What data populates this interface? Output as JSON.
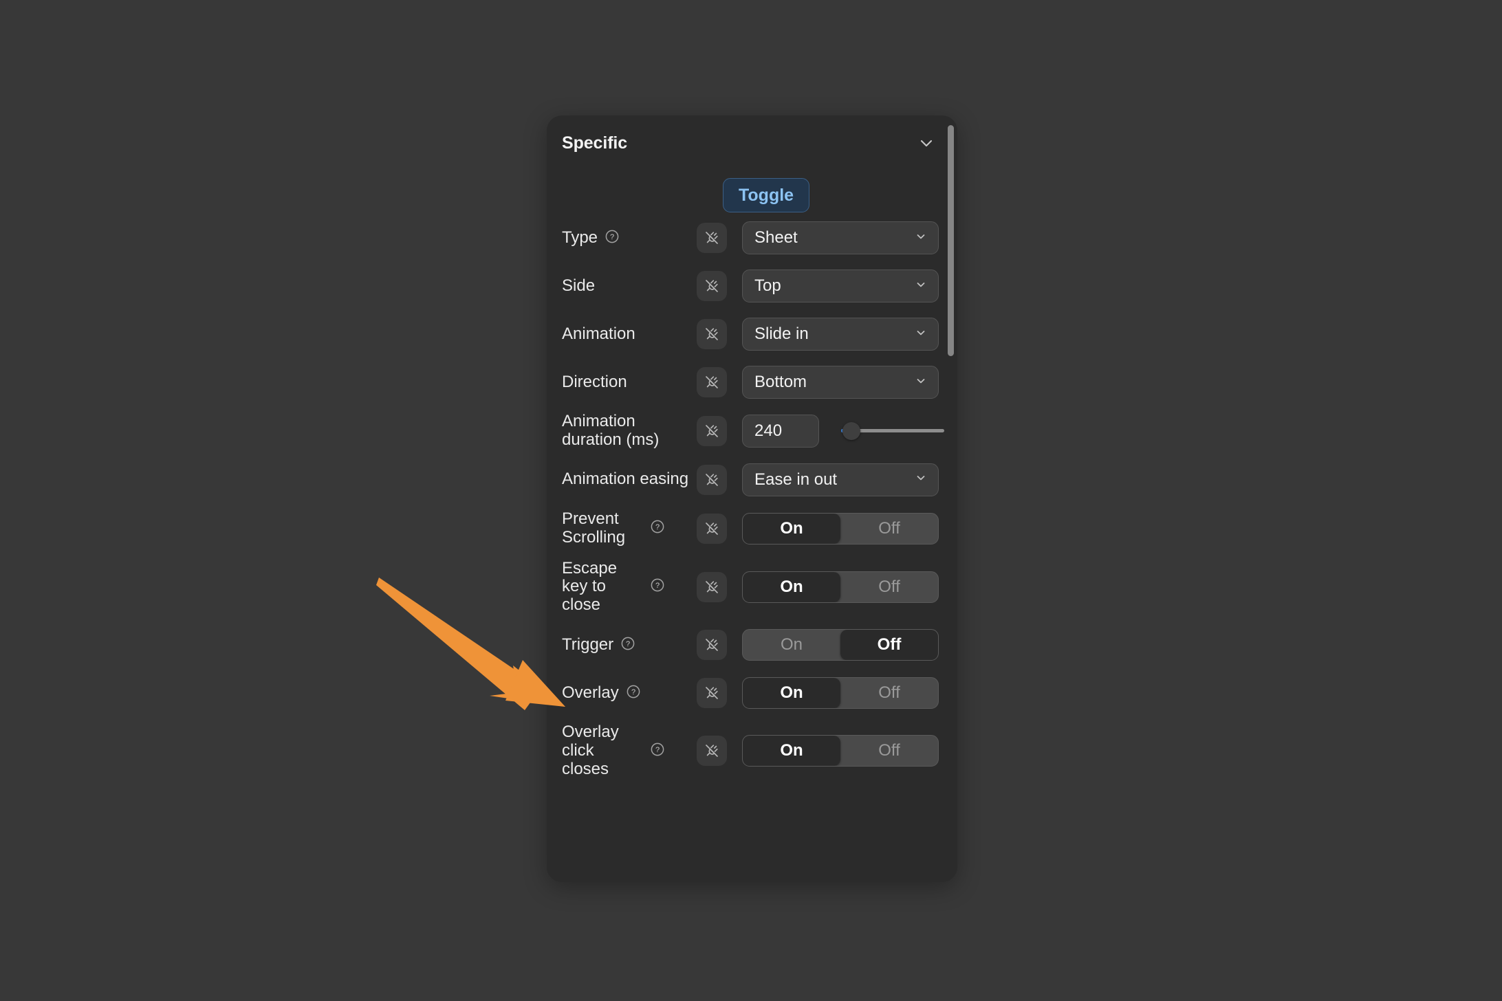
{
  "theme": {
    "page_background": "#383838",
    "panel_background": "#2b2b2b",
    "accent_blue": "#3b7fd4",
    "badge_text": "#8cc3f2",
    "badge_background": "#22364c",
    "annotation_arrow": "#ef9338",
    "text_primary": "#f2f2f2",
    "text_muted": "#9a9a9a"
  },
  "panel": {
    "title": "Specific",
    "collapse_icon": "chevron-down-icon",
    "scrollbar": {
      "visible": true
    }
  },
  "badge": {
    "label": "Toggle"
  },
  "icons": {
    "plug": "plug-disconnected-icon",
    "help": "help-circle-icon",
    "chevron": "chevron-down-icon"
  },
  "rows": [
    {
      "label": "Type",
      "has_help": true,
      "control": "select",
      "value": "Sheet"
    },
    {
      "label": "Side",
      "has_help": false,
      "control": "select",
      "value": "Top"
    },
    {
      "label": "Animation",
      "has_help": false,
      "control": "select",
      "value": "Slide in"
    },
    {
      "label": "Direction",
      "has_help": false,
      "control": "select",
      "value": "Bottom"
    },
    {
      "label": "Animation duration (ms)",
      "has_help": false,
      "control": "number-slider",
      "value": "240",
      "slider_percent": 4
    },
    {
      "label": "Animation easing",
      "has_help": false,
      "control": "select",
      "value": "Ease in out"
    },
    {
      "label": "Prevent Scrolling",
      "has_help": true,
      "control": "segmented",
      "on_label": "On",
      "off_label": "Off",
      "selected": "On"
    },
    {
      "label": "Escape key to close",
      "has_help": true,
      "control": "segmented",
      "on_label": "On",
      "off_label": "Off",
      "selected": "On"
    },
    {
      "label": "Trigger",
      "has_help": true,
      "control": "segmented",
      "on_label": "On",
      "off_label": "Off",
      "selected": "Off"
    },
    {
      "label": "Overlay",
      "has_help": true,
      "control": "segmented",
      "on_label": "On",
      "off_label": "Off",
      "selected": "On"
    },
    {
      "label": "Overlay click closes",
      "has_help": true,
      "control": "segmented",
      "on_label": "On",
      "off_label": "Off",
      "selected": "On"
    }
  ],
  "annotation": {
    "type": "arrow",
    "points_to": "Trigger",
    "color": "#ef9338"
  }
}
